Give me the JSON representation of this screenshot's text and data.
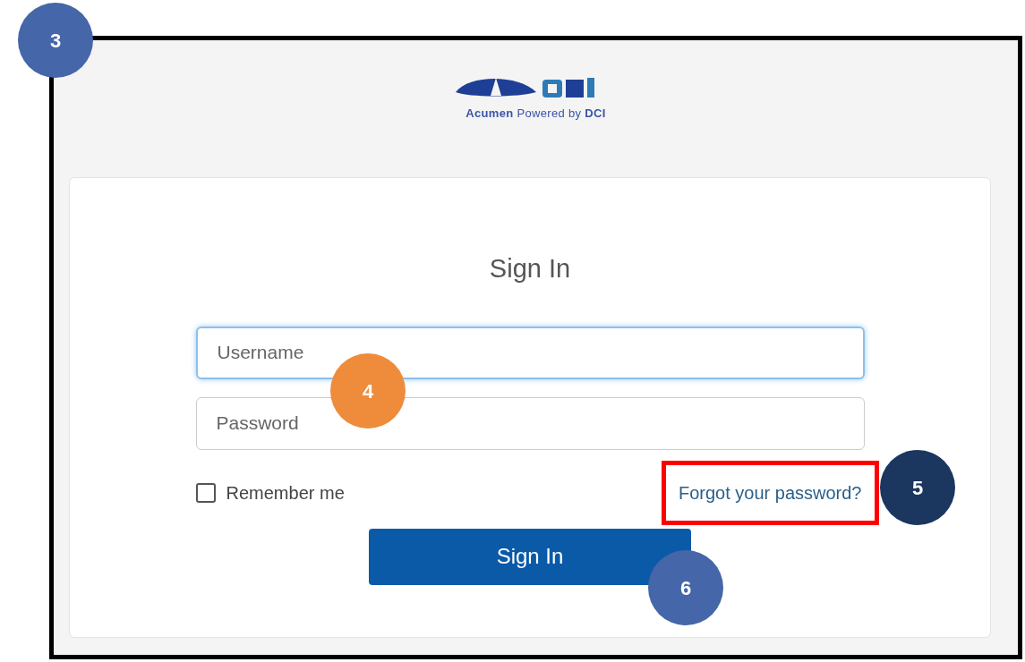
{
  "logo": {
    "caption": "**Acumen** Powered by **DCI**"
  },
  "card": {
    "title": "Sign In"
  },
  "fields": [
    {
      "placeholder": "Username",
      "focused": true
    },
    {
      "placeholder": "Password",
      "focused": false
    }
  ],
  "remember": {
    "label": "Remember me",
    "checked": false
  },
  "forgot_link": {
    "text": "Forgot your password?",
    "highlighted": true
  },
  "submit_button": {
    "label": "Sign In"
  },
  "callouts": [
    {
      "label": "3",
      "color": "#4566a8"
    },
    {
      "label": "4",
      "color": "#ee8c3b"
    },
    {
      "label": "5",
      "color": "#1b365f"
    },
    {
      "label": "6",
      "color": "#4566a8"
    }
  ]
}
